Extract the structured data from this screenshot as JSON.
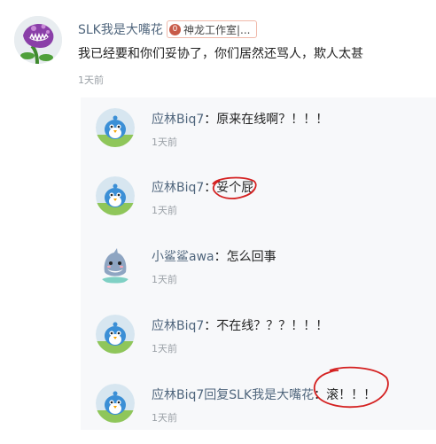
{
  "comment": {
    "author": "SLK我是大嘴花",
    "badge_text": "神龙工作室|...",
    "badge_icon": "0",
    "text": "我已经要和你们妥协了，你们居然还骂人，欺人太甚",
    "time": "1天前"
  },
  "replies": [
    {
      "name": "应林Biq7",
      "sep": "：",
      "text": "原来在线啊？！！！",
      "time": "1天前"
    },
    {
      "name": "应林Biq7",
      "sep": "：",
      "text": "妥个屁",
      "time": "1天前"
    },
    {
      "name": "小鲨鲨awa",
      "sep": "：",
      "text": "怎么回事",
      "time": "1天前"
    },
    {
      "name": "应林Biq7",
      "sep": "：",
      "text": "不在线？？？！！！",
      "time": "1天前"
    },
    {
      "name": "应林Biq7回复SLK我是大嘴花",
      "sep": "：",
      "text": "滚！！！",
      "time": "1天前"
    }
  ],
  "colors": {
    "link": "#50667d",
    "muted": "#9aa0a6",
    "reply_bg": "#f7f8fa",
    "annotation": "#d42020"
  }
}
